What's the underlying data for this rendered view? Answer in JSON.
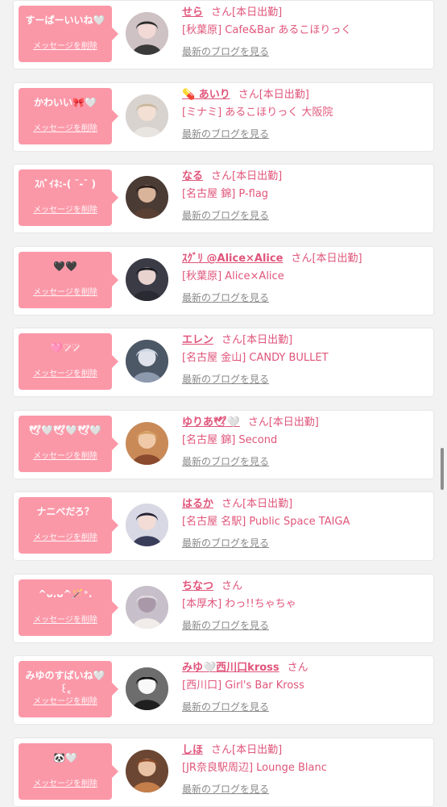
{
  "delete_label": "メッセージを削除",
  "blog_label": "最新のブログを見る",
  "honorific": "さん",
  "entries": [
    {
      "message": "すーぱーいいね🤍",
      "name": "せら",
      "status": "[本日出勤]",
      "shop": "[秋葉原] Cafe&Bar あるこほりっく"
    },
    {
      "message": "かわいい🎀🤍",
      "name": "💊 あいり",
      "status": "[本日出勤]",
      "shop": "[ミナミ] あるこほりっく 大阪院"
    },
    {
      "message": "ｽﾊﾞｲﾈ:-( ¯‐¯ )",
      "name": "なる",
      "status": "[本日出勤]",
      "shop": "[名古屋 錦] P-flag"
    },
    {
      "message": "🖤🖤",
      "name": "ｽｸﾞﾘ @Alice×Alice",
      "status": "[本日出勤]",
      "shop": "[秋葉原] Alice×Alice"
    },
    {
      "message": "🩷♡̷♡̷",
      "name": "エレン",
      "status": "[本日出勤]",
      "shop": "[名古屋 金山] CANDY BULLET"
    },
    {
      "message": "🕊🤍🕊🤍🕊🤍",
      "name": "ゆりあ🕊🤍",
      "status": "[本日出勤]",
      "shop": "[名古屋 錦] Second"
    },
    {
      "message": "ナニべだろ？",
      "name": "はるか",
      "status": "[本日出勤]",
      "shop": "[名古屋 名駅] Public Space TAIGA"
    },
    {
      "message": "^ᴗ.ᴗ^🪄⁺.",
      "name": "ちなつ",
      "status": "",
      "shop": "[本厚木] わっ!!ちゃちゃ"
    },
    {
      "message": "みゆのすばいね🤍 ꒰꜀",
      "name": "みゆ🤍西川口kross",
      "status": "",
      "shop": "[西川口] Girl's Bar Kross"
    },
    {
      "message": "🐼🤍",
      "name": "しほ",
      "status": "[本日出勤]",
      "shop": "[JR奈良駅周辺] Lounge Blanc"
    }
  ],
  "colors": {
    "accent": "#e0557a",
    "bubble": "#fb98a8",
    "background": "#f2f2f2"
  }
}
